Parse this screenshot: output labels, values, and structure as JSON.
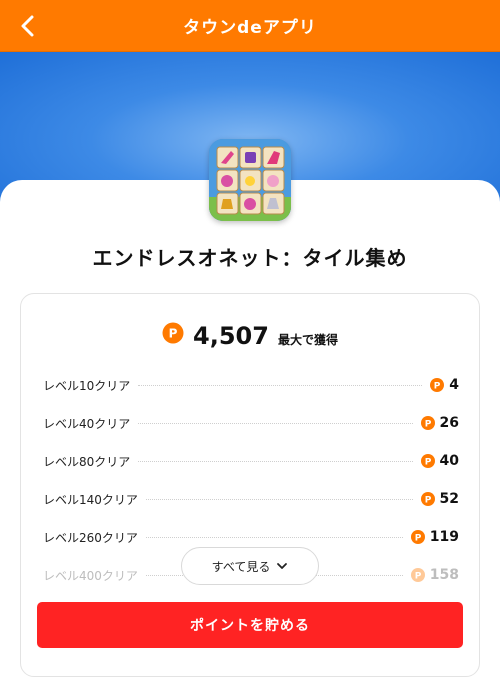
{
  "header": {
    "title": "タウンdeアプリ",
    "back_icon": "chevron-left-icon"
  },
  "app": {
    "name": "エンドレスオネット：タイル集め",
    "icon": "tile-puzzle-app-icon"
  },
  "reward": {
    "total_points": "4,507",
    "total_suffix": "最大で獲得",
    "coin_icon": "point-coin-icon",
    "coin_color": "#ff7a00",
    "levels": [
      {
        "label": "レベル10クリア",
        "points": "4"
      },
      {
        "label": "レベル40クリア",
        "points": "26"
      },
      {
        "label": "レベル80クリア",
        "points": "40"
      },
      {
        "label": "レベル140クリア",
        "points": "52"
      },
      {
        "label": "レベル260クリア",
        "points": "119"
      },
      {
        "label": "レベル400クリア",
        "points": "158"
      }
    ]
  },
  "actions": {
    "see_all_label": "すべて見る",
    "save_points_label": "ポイントを貯める"
  },
  "colors": {
    "header_bg": "#ff7a00",
    "primary_button": "#ff2323",
    "hero_blue": "#3d8ae6"
  }
}
